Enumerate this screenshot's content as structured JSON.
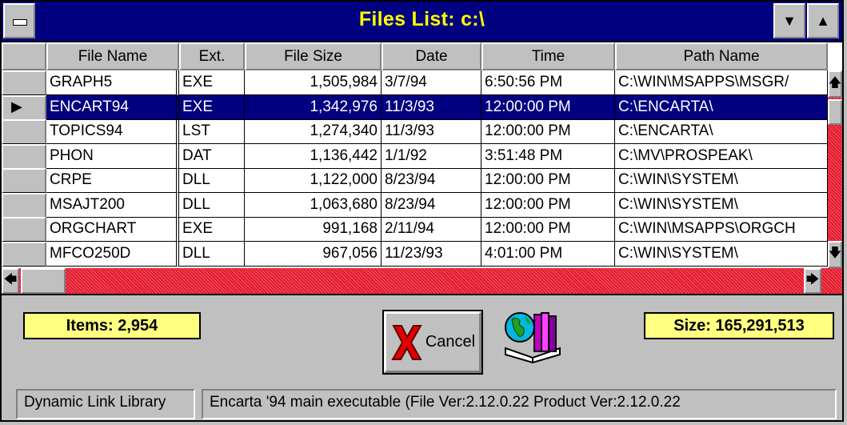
{
  "window": {
    "title": "Files List: c:\\"
  },
  "icons": {
    "system_menu": "system-menu-icon",
    "minimize": "▼",
    "maximize": "▲",
    "scroll_up": "🡅",
    "scroll_down": "🡇",
    "scroll_left": "🡄",
    "scroll_right": "🡆",
    "row_pointer": "▶",
    "cancel": "red-x-icon",
    "globe_book": "globe-book-icon"
  },
  "table": {
    "columns": [
      "File Name",
      "Ext.",
      "File Size",
      "Date",
      "Time",
      "Path Name"
    ],
    "rows": [
      [
        "GRAPH5",
        "EXE",
        "1,505,984",
        "3/7/94",
        "6:50:56 PM",
        "C:\\WIN\\MSAPPS\\MSGR/"
      ],
      [
        "ENCART94",
        "EXE",
        "1,342,976",
        "11/3/93",
        "12:00:00 PM",
        "C:\\ENCARTA\\"
      ],
      [
        "TOPICS94",
        "LST",
        "1,274,340",
        "11/3/93",
        "12:00:00 PM",
        "C:\\ENCARTA\\"
      ],
      [
        "PHON",
        "DAT",
        "1,136,442",
        "1/1/92",
        "3:51:48 PM",
        "C:\\MV\\PROSPEAK\\"
      ],
      [
        "CRPE",
        "DLL",
        "1,122,000",
        "8/23/94",
        "12:00:00 PM",
        "C:\\WIN\\SYSTEM\\"
      ],
      [
        "MSAJT200",
        "DLL",
        "1,063,680",
        "8/23/94",
        "12:00:00 PM",
        "C:\\WIN\\SYSTEM\\"
      ],
      [
        "ORGCHART",
        "EXE",
        "991,168",
        "2/11/94",
        "12:00:00 PM",
        "C:\\WIN\\MSAPPS\\ORGCH"
      ],
      [
        "MFCO250D",
        "DLL",
        "967,056",
        "11/23/93",
        "4:01:00 PM",
        "C:\\WIN\\SYSTEM\\"
      ]
    ],
    "selected_row": 1
  },
  "items": "Items: 2,954",
  "size": "Size: 165,291,513",
  "cancel_button": "Cancel",
  "status": {
    "left": "Dynamic Link Library",
    "right": "Encarta '94 main executable (File Ver:2.12.0.22  Product Ver:2.12.0.22"
  },
  "colors": {
    "title_bg": "#000080",
    "title_text": "#ffff00",
    "selection": "#000080",
    "info_box": "#ffff80",
    "scroll_track": "#e21b2b"
  }
}
